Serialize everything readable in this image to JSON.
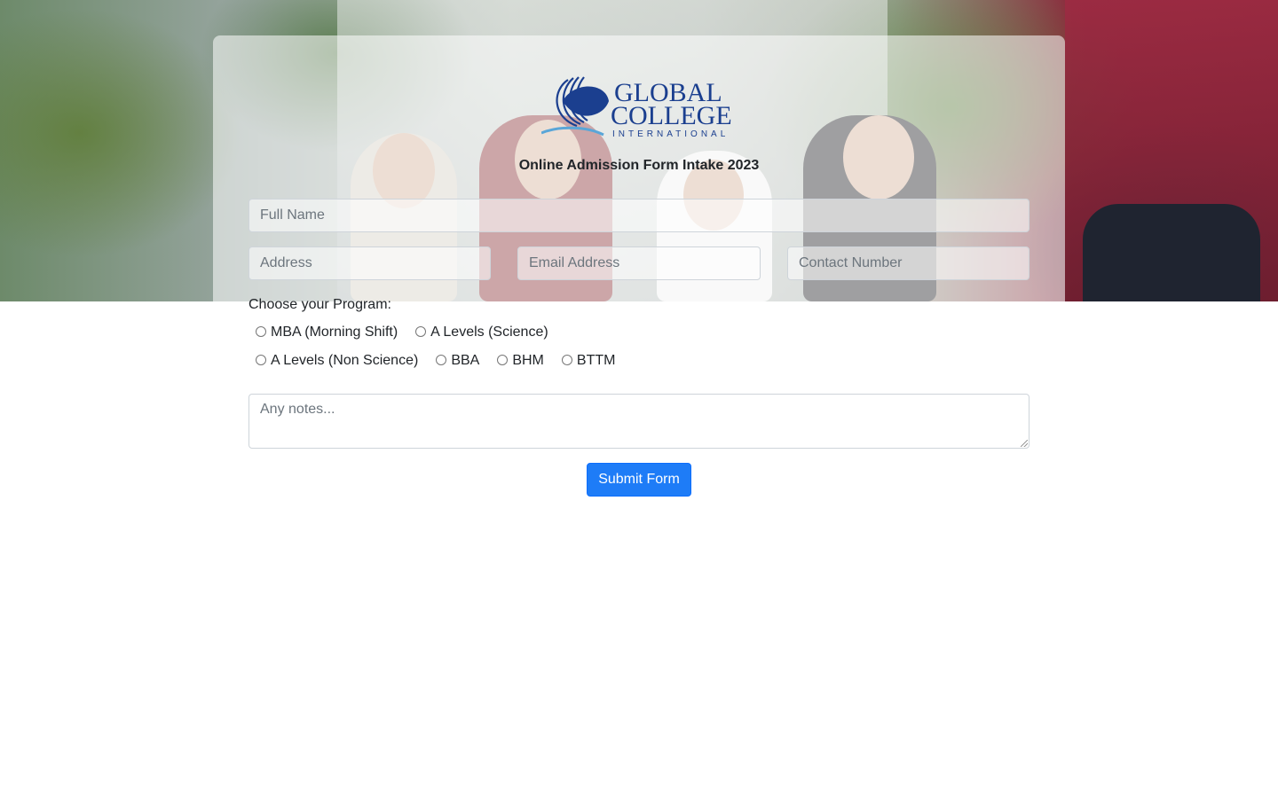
{
  "logo": {
    "line1": "GLOBAL",
    "line2": "COLLEGE",
    "line3": "INTERNATIONAL"
  },
  "form": {
    "title": "Online Admission Form Intake 2023",
    "full_name_placeholder": "Full Name",
    "address_placeholder": "Address",
    "email_placeholder": "Email Address",
    "contact_placeholder": "Contact Number",
    "program_label": "Choose your Program:",
    "programs_row1": [
      "MBA (Morning Shift)",
      "A Levels (Science)"
    ],
    "programs_row2": [
      "A Levels (Non Science)",
      "BBA",
      "BHM",
      "BTTM"
    ],
    "notes_placeholder": "Any notes...",
    "submit_label": "Submit Form"
  },
  "colors": {
    "primary": "#1e7cf7",
    "logo_blue": "#1b3f8f",
    "logo_lightblue": "#5aa6d8"
  }
}
